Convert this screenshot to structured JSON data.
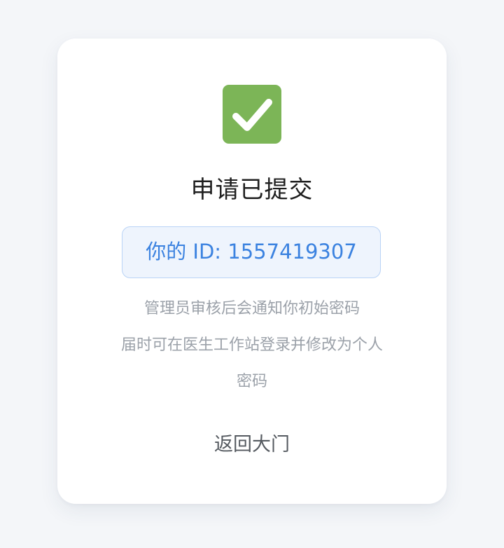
{
  "result": {
    "title": "申请已提交",
    "id_label": "你的 ID:",
    "id_value": "1557419307",
    "notice_lines": [
      "管理员审核后会通知你初始密码",
      "届时可在医生工作站登录并修改为个人",
      "密码"
    ],
    "back_label": "返回大门",
    "icon": "check-mark-icon"
  },
  "colors": {
    "page_background": "#f4f6f9",
    "card_background": "#ffffff",
    "success_green": "#7cb557",
    "id_text_blue": "#3b82e0",
    "id_box_background": "#eef4fd",
    "id_box_border": "#b9d3f6",
    "title_text": "#1f1f1f",
    "notice_text": "#9ba1a9",
    "back_text": "#555a60"
  }
}
